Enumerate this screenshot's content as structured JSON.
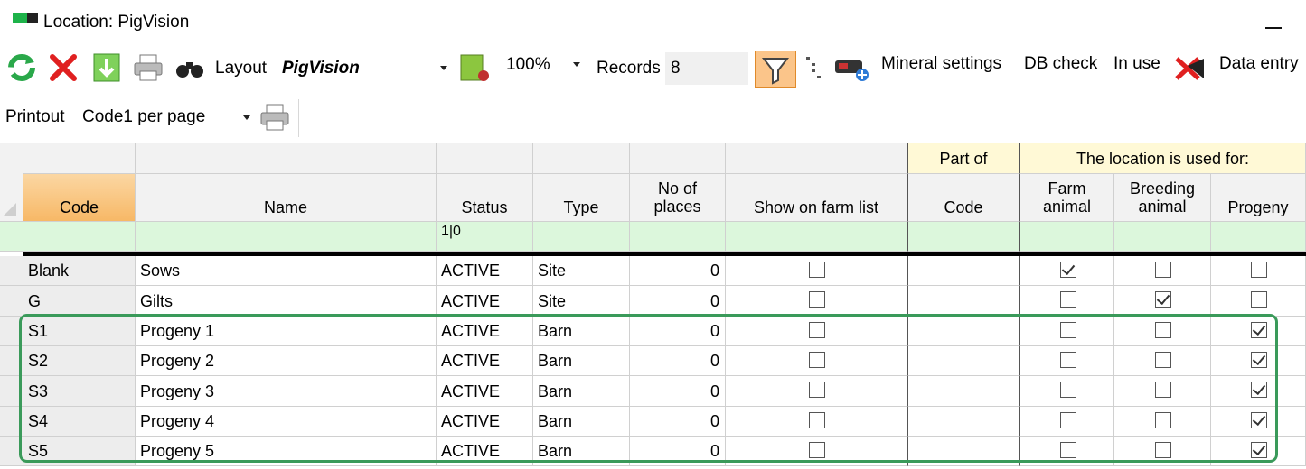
{
  "window": {
    "title": "Location: PigVision"
  },
  "toolbar": {
    "layout_label": "Layout",
    "layout_value": "PigVision",
    "zoom_value": "100%",
    "records_label": "Records",
    "records_value": "8",
    "mineral_settings": "Mineral settings",
    "db_check": "DB check",
    "in_use": "In use",
    "data_entry": "Data entry",
    "printout_label": "Printout",
    "printout_value": "Code1 per page"
  },
  "grid": {
    "group_part_of": "Part of",
    "group_used_for": "The location is used for:",
    "columns": {
      "code": "Code",
      "name": "Name",
      "status": "Status",
      "type": "Type",
      "places": "No of places",
      "show_on_farm_list": "Show on farm list",
      "part_of_code": "Code",
      "farm_animal": "Farm animal",
      "breeding_animal": "Breeding animal",
      "progeny": "Progeny"
    },
    "filter_status": "1|0",
    "rows": [
      {
        "code": "Blank",
        "name": "Sows",
        "status": "ACTIVE",
        "type": "Site",
        "places": "0",
        "show": false,
        "farm": true,
        "breeding": false,
        "progeny": false
      },
      {
        "code": "G",
        "name": "Gilts",
        "status": "ACTIVE",
        "type": "Site",
        "places": "0",
        "show": false,
        "farm": false,
        "breeding": true,
        "progeny": false
      },
      {
        "code": "S1",
        "name": "Progeny 1",
        "status": "ACTIVE",
        "type": "Barn",
        "places": "0",
        "show": false,
        "farm": false,
        "breeding": false,
        "progeny": true
      },
      {
        "code": "S2",
        "name": "Progeny 2",
        "status": "ACTIVE",
        "type": "Barn",
        "places": "0",
        "show": false,
        "farm": false,
        "breeding": false,
        "progeny": true
      },
      {
        "code": "S3",
        "name": "Progeny 3",
        "status": "ACTIVE",
        "type": "Barn",
        "places": "0",
        "show": false,
        "farm": false,
        "breeding": false,
        "progeny": true
      },
      {
        "code": "S4",
        "name": "Progeny 4",
        "status": "ACTIVE",
        "type": "Barn",
        "places": "0",
        "show": false,
        "farm": false,
        "breeding": false,
        "progeny": true
      },
      {
        "code": "S5",
        "name": "Progeny 5",
        "status": "ACTIVE",
        "type": "Barn",
        "places": "0",
        "show": false,
        "farm": false,
        "breeding": false,
        "progeny": true
      }
    ]
  },
  "colors": {
    "highlight": "#3a9a5a",
    "filter_row": "#dcf7dc",
    "code_header": "#f7b866",
    "group_header": "#fff9d6"
  }
}
